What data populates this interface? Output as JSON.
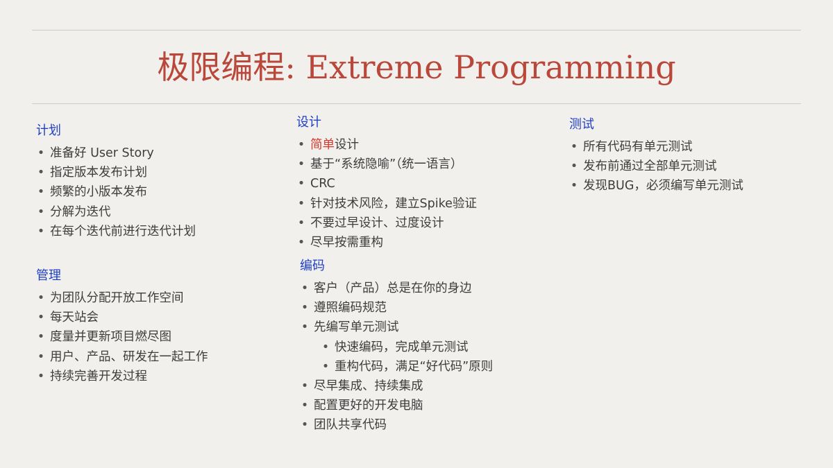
{
  "slide": {
    "title": "极限编程: Extreme Programming"
  },
  "sections": {
    "plan": {
      "heading": "计划",
      "items": [
        "准备好 User Story",
        "指定版本发布计划",
        "频繁的小版本发布",
        "分解为迭代",
        "在每个迭代前进行迭代计划"
      ]
    },
    "manage": {
      "heading": "管理",
      "items": [
        "为团队分配开放工作空间",
        "每天站会",
        "度量并更新项目燃尽图",
        "用户、产品、研发在一起工作",
        "持续完善开发过程"
      ]
    },
    "design": {
      "heading": "设计",
      "item0_highlight": "简单",
      "item0_rest": "设计",
      "items": [
        "基于“系统隐喻”（统一语言）",
        "CRC",
        "针对技术风险，建立Spike验证",
        "不要过早设计、过度设计",
        "尽早按需重构"
      ]
    },
    "code": {
      "heading": "编码",
      "items": [
        "客户（产品）总是在你的身边",
        "遵照编码规范",
        "先编写单元测试"
      ],
      "subitems": [
        "快速编码，完成单元测试",
        "重构代码，满足“好代码”原则"
      ],
      "items_after": [
        "尽早集成、持续集成",
        "配置更好的开发电脑",
        "团队共享代码"
      ]
    },
    "test": {
      "heading": "测试",
      "items": [
        "所有代码有单元测试",
        "发布前通过全部单元测试",
        "发现BUG，必须编写单元测试"
      ]
    }
  },
  "bullet_symbol": "•",
  "colors": {
    "title": "#b9473a",
    "heading": "#1e3fc7",
    "highlight": "#d3392d",
    "text": "#3d3d3d",
    "background": "#f2f0ed"
  }
}
